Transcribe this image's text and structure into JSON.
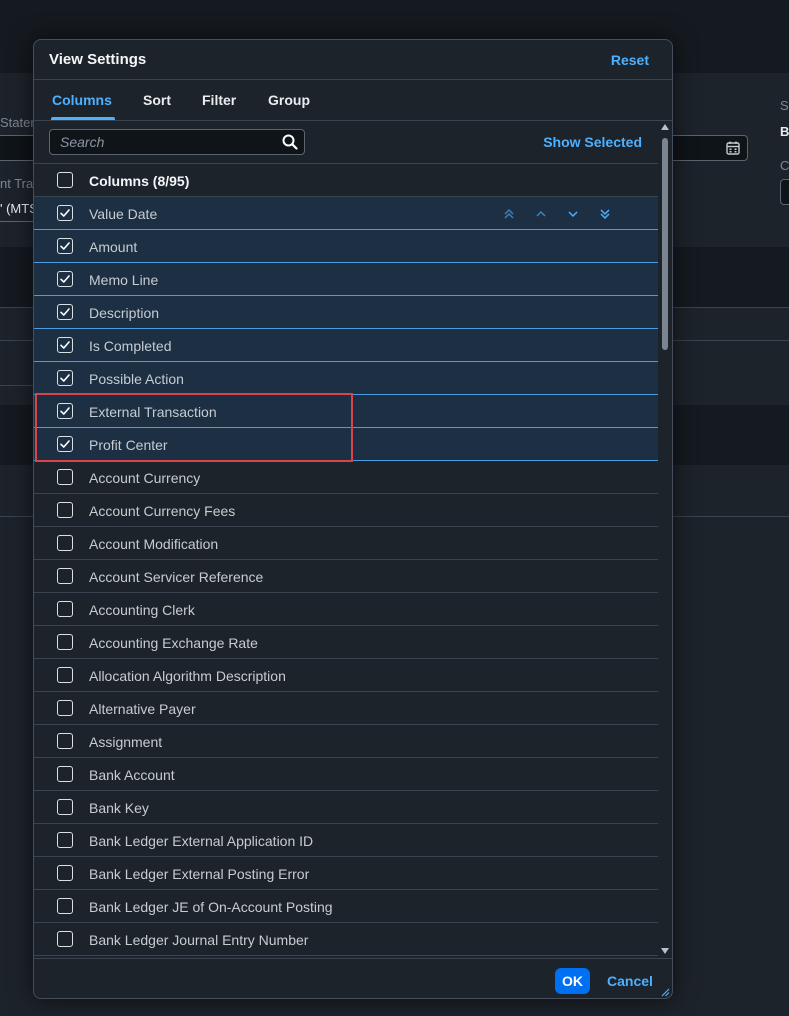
{
  "background": {
    "label_statement": "Statem",
    "label_transaction": "nt Tra",
    "value_transaction": "' (MTS",
    "label_right_s": "S",
    "label_right_b": "B",
    "label_right_c": "C"
  },
  "dialog": {
    "title": "View Settings",
    "reset_label": "Reset",
    "tabs": [
      {
        "label": "Columns",
        "active": true
      },
      {
        "label": "Sort",
        "active": false
      },
      {
        "label": "Filter",
        "active": false
      },
      {
        "label": "Group",
        "active": false
      }
    ],
    "search": {
      "placeholder": "Search",
      "value": ""
    },
    "show_selected_label": "Show Selected",
    "columns_header": {
      "label": "Columns (8/95)",
      "checked": false
    },
    "columns": [
      {
        "label": "Value Date",
        "checked": true
      },
      {
        "label": "Amount",
        "checked": true
      },
      {
        "label": "Memo Line",
        "checked": true
      },
      {
        "label": "Description",
        "checked": true
      },
      {
        "label": "Is Completed",
        "checked": true
      },
      {
        "label": "Possible Action",
        "checked": true
      },
      {
        "label": "External Transaction",
        "checked": true
      },
      {
        "label": "Profit Center",
        "checked": true
      },
      {
        "label": "Account Currency",
        "checked": false
      },
      {
        "label": "Account Currency Fees",
        "checked": false
      },
      {
        "label": "Account Modification",
        "checked": false
      },
      {
        "label": "Account Servicer Reference",
        "checked": false
      },
      {
        "label": "Accounting Clerk",
        "checked": false
      },
      {
        "label": "Accounting Exchange Rate",
        "checked": false
      },
      {
        "label": "Allocation Algorithm Description",
        "checked": false
      },
      {
        "label": "Alternative Payer",
        "checked": false
      },
      {
        "label": "Assignment",
        "checked": false
      },
      {
        "label": "Bank Account",
        "checked": false
      },
      {
        "label": "Bank Key",
        "checked": false
      },
      {
        "label": "Bank Ledger External Application ID",
        "checked": false
      },
      {
        "label": "Bank Ledger External Posting Error",
        "checked": false
      },
      {
        "label": "Bank Ledger JE of On-Account Posting",
        "checked": false
      },
      {
        "label": "Bank Ledger Journal Entry Number",
        "checked": false
      }
    ],
    "move_icons": [
      "move-to-top-icon",
      "move-up-icon",
      "move-down-icon",
      "move-to-bottom-icon"
    ],
    "ok_label": "OK",
    "cancel_label": "Cancel"
  },
  "colors": {
    "accent": "#4db1ff",
    "primary_button": "#0070f2",
    "selected_row": "#1c2f43",
    "highlight_box": "#d9434a"
  }
}
